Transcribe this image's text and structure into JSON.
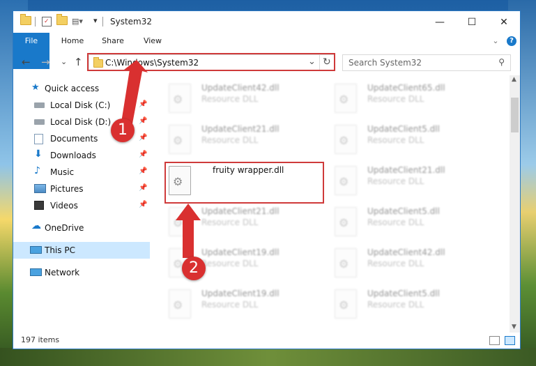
{
  "window": {
    "title": "System32",
    "minimize": "—",
    "maximize": "☐",
    "close": "✕"
  },
  "ribbon": {
    "tabs": [
      "File",
      "Home",
      "Share",
      "View"
    ],
    "expand": "⌄",
    "help": "?"
  },
  "address": {
    "path": "C:\\Windows\\System32",
    "dropdown": "⌄",
    "refresh": "↻",
    "search_placeholder": "Search System32",
    "back": "←",
    "forward": "→",
    "recent": "⌄",
    "up": "↑"
  },
  "nav": {
    "items": [
      {
        "label": "Quick access",
        "icon": "star-icon"
      },
      {
        "label": "Local Disk (C:)",
        "icon": "drive-icon",
        "pinned": true
      },
      {
        "label": "Local Disk (D:)",
        "icon": "drive-icon",
        "pinned": true
      },
      {
        "label": "Documents",
        "icon": "documents-icon",
        "pinned": true
      },
      {
        "label": "Downloads",
        "icon": "download-icon",
        "pinned": true
      },
      {
        "label": "Music",
        "icon": "music-icon",
        "pinned": true
      },
      {
        "label": "Pictures",
        "icon": "pictures-icon",
        "pinned": true
      },
      {
        "label": "Videos",
        "icon": "videos-icon",
        "pinned": true
      },
      {
        "label": "OneDrive",
        "icon": "onedrive-icon"
      },
      {
        "label": "This PC",
        "icon": "pc-icon",
        "selected": true
      },
      {
        "label": "Network",
        "icon": "network-icon"
      }
    ]
  },
  "files": {
    "left": [
      {
        "name": "UpdateClient42.dll",
        "type": "Resource DLL"
      },
      {
        "name": "UpdateClient21.dll",
        "type": "Resource DLL"
      },
      {
        "name": "fruity wrapper.dll",
        "type": ""
      },
      {
        "name": "UpdateClient21.dll",
        "type": "Resource DLL"
      },
      {
        "name": "UpdateClient19.dll",
        "type": "Resource DLL"
      },
      {
        "name": "UpdateClient19.dll",
        "type": "Resource DLL"
      }
    ],
    "right": [
      {
        "name": "UpdateClient65.dll",
        "type": "Resource DLL"
      },
      {
        "name": "UpdateClient5.dll",
        "type": "Resource DLL"
      },
      {
        "name": "UpdateClient21.dll",
        "type": "Resource DLL"
      },
      {
        "name": "UpdateClient5.dll",
        "type": "Resource DLL"
      },
      {
        "name": "UpdateClient42.dll",
        "type": "Resource DLL"
      },
      {
        "name": "UpdateClient5.dll",
        "type": "Resource DLL"
      }
    ]
  },
  "status": {
    "items": "197 items"
  },
  "callouts": {
    "one": "1",
    "two": "2"
  },
  "colors": {
    "accent": "#1979ca",
    "highlight": "#cf3a3a"
  }
}
